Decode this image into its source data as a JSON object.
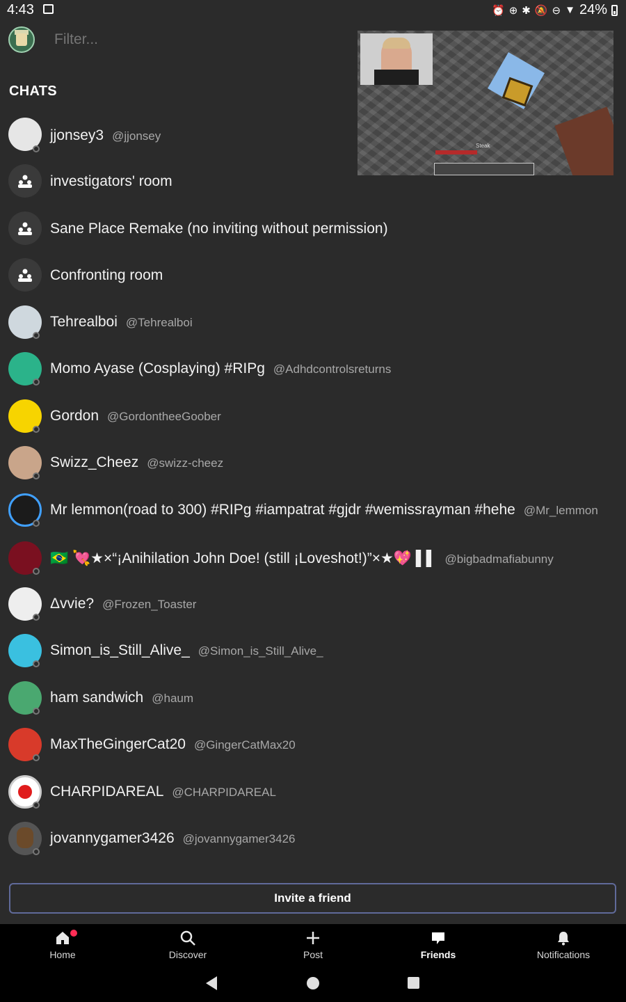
{
  "status_bar": {
    "time": "4:43",
    "battery": "24%",
    "icons": [
      "alarm-icon",
      "sync-icon",
      "bluetooth-icon",
      "notifications-off-icon",
      "dnd-icon",
      "wifi-icon",
      "battery-icon"
    ]
  },
  "header": {
    "filter_placeholder": "Filter...",
    "chats_heading": "CHATS"
  },
  "pip": {
    "hud_text": "Steak"
  },
  "chats": [
    {
      "name": "jjonsey3",
      "handle": "@jjonsey",
      "type": "dm"
    },
    {
      "name": "investigators' room",
      "handle": "",
      "type": "group"
    },
    {
      "name": "Sane Place Remake (no inviting without permission)",
      "handle": "",
      "type": "group"
    },
    {
      "name": "Confronting room",
      "handle": "",
      "type": "group"
    },
    {
      "name": "Tehrealboi",
      "handle": "@Tehrealboi",
      "type": "dm"
    },
    {
      "name": "Momo Ayase (Cosplaying) #RIPg",
      "handle": "@Adhdcontrolsreturns",
      "type": "dm"
    },
    {
      "name": "Gordon",
      "handle": "@GordontheeGoober",
      "type": "dm"
    },
    {
      "name": "Swizz_Cheez",
      "handle": "@swizz-cheez",
      "type": "dm"
    },
    {
      "name": "Mr lemmon(road to 300) #RIPg  #iampatrat #gjdr #wemissrayman #hehe",
      "handle": "@Mr_lemmon",
      "type": "dm"
    },
    {
      "name": "🇧🇷 💘★×“¡Anihilation John Doe! (still ¡Loveshot!)”×★💖 ▌▌",
      "handle": "@bigbadmafiabunny",
      "type": "dm"
    },
    {
      "name": "Δvvie?",
      "handle": "@Frozen_Toaster",
      "type": "dm"
    },
    {
      "name": "Simon_is_Still_Alive_",
      "handle": "@Simon_is_Still_Alive_",
      "type": "dm"
    },
    {
      "name": "ham sandwich",
      "handle": "@haum",
      "type": "dm"
    },
    {
      "name": "MaxTheGingerCat20",
      "handle": "@GingerCatMax20",
      "type": "dm"
    },
    {
      "name": "CHARPIDAREAL",
      "handle": "@CHARPIDAREAL",
      "type": "dm"
    },
    {
      "name": "jovannygamer3426",
      "handle": "@jovannygamer3426",
      "type": "dm"
    }
  ],
  "invite": {
    "label": "Invite a friend"
  },
  "bottom_nav": [
    {
      "label": "Home",
      "icon": "home-icon",
      "active": false,
      "badge": true
    },
    {
      "label": "Discover",
      "icon": "search-icon",
      "active": false,
      "badge": false
    },
    {
      "label": "Post",
      "icon": "plus-icon",
      "active": false,
      "badge": false
    },
    {
      "label": "Friends",
      "icon": "chat-bubble-icon",
      "active": true,
      "badge": false
    },
    {
      "label": "Notifications",
      "icon": "bell-icon",
      "active": false,
      "badge": false
    }
  ],
  "colors": {
    "background": "#2b2b2b",
    "accent_border": "#606a9a",
    "badge": "#ff2d55"
  }
}
